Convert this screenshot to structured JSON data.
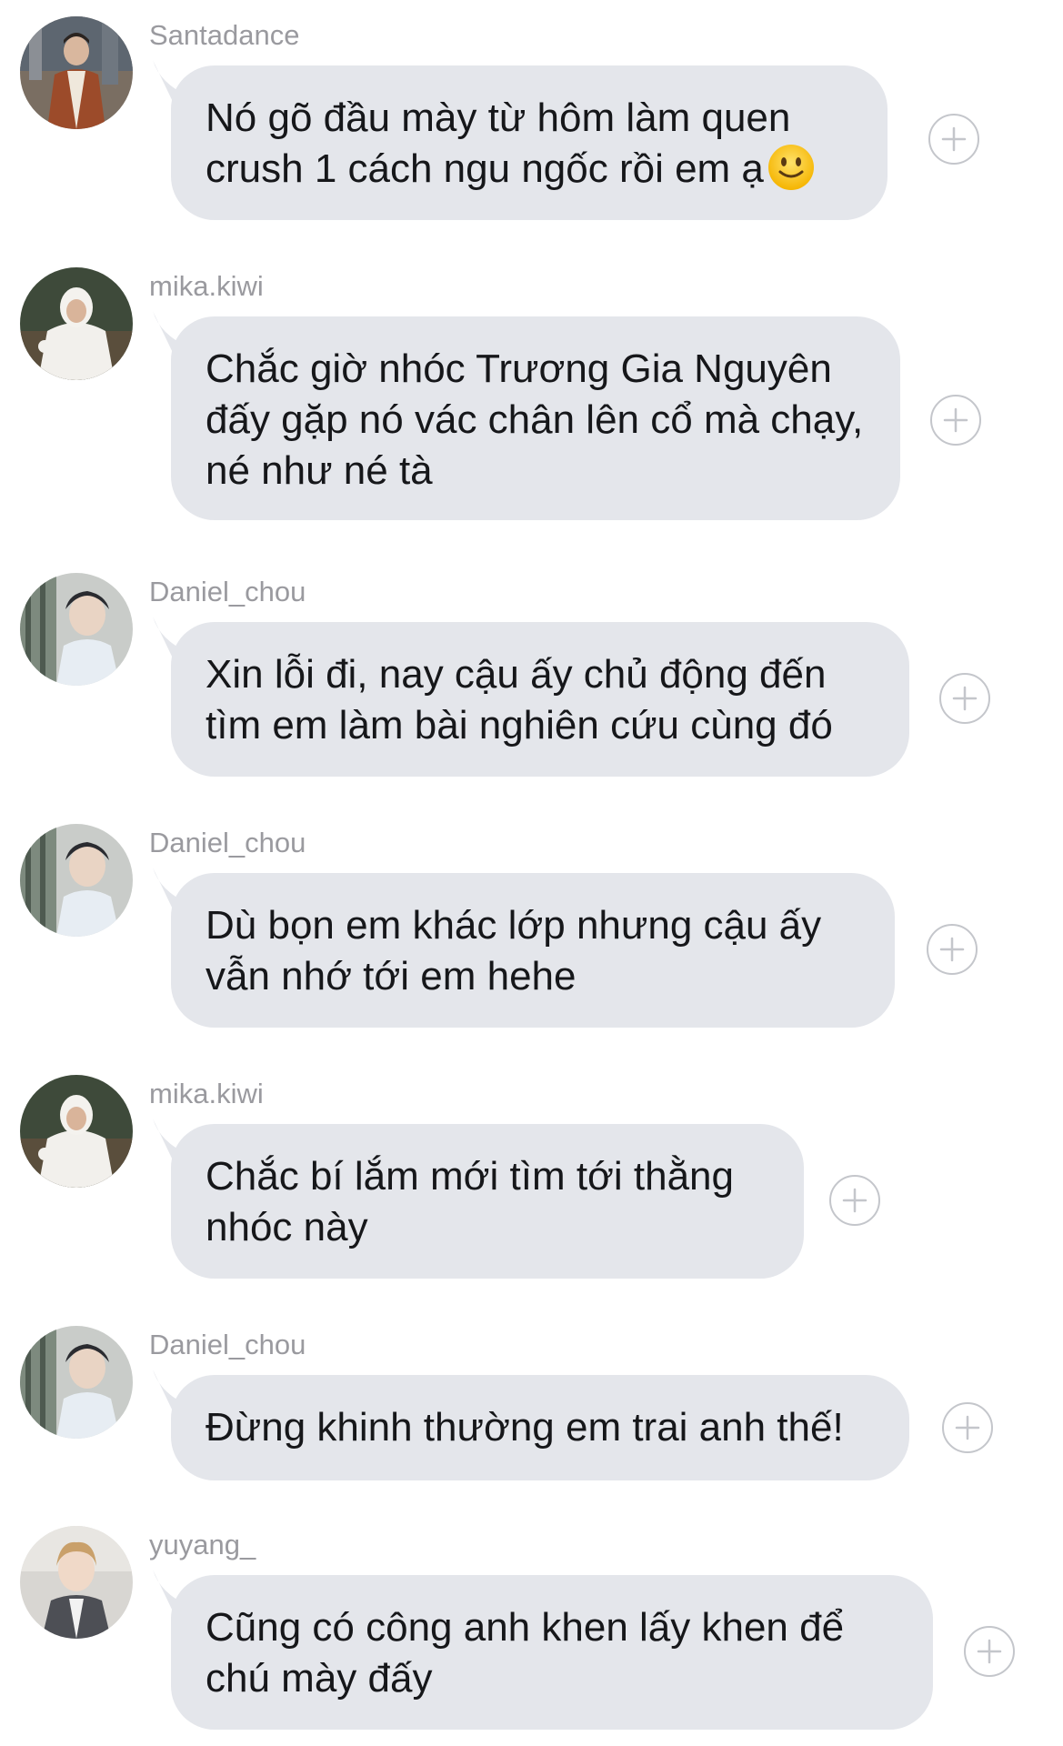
{
  "messages": [
    {
      "username": "Santadance",
      "text": "Nó gõ đầu mày từ hôm làm quen crush 1 cách ngu ngốc rồi em ạ",
      "emoji": "slightly-smiling-face"
    },
    {
      "username": "mika.kiwi",
      "text": "Chắc giờ nhóc Trương Gia Nguyên đấy gặp nó vác chân lên cổ mà chạy, né như né tà"
    },
    {
      "username": "Daniel_chou",
      "text": "Xin lỗi đi, nay cậu ấy chủ động đến tìm em làm bài nghiên cứu cùng đó"
    },
    {
      "username": "Daniel_chou",
      "text": "Dù bọn em khác lớp nhưng cậu ấy vẫn nhớ tới em hehe"
    },
    {
      "username": "mika.kiwi",
      "text": "Chắc bí lắm mới tìm tới thằng nhóc này"
    },
    {
      "username": "Daniel_chou",
      "text": "Đừng khinh thường em trai anh thế!"
    },
    {
      "username": "yuyang_",
      "text": "Cũng có công anh khen lấy khen để chú mày đấy"
    }
  ],
  "icons": {
    "add_reaction": "plus-circle-icon",
    "emoji": "slightly-smiling-face-icon"
  },
  "colors": {
    "bubble": "#e4e6eb",
    "username": "#9a9a9f",
    "text": "#16171a",
    "icon_border": "#c4c6cb"
  }
}
